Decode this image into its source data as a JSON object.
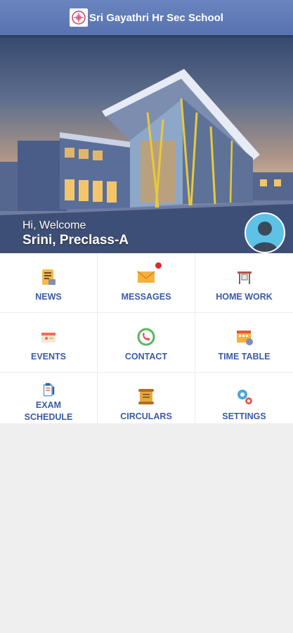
{
  "header": {
    "title": "Sri Gayathri Hr Sec School",
    "logo_icon": "school-logo-icon"
  },
  "hero": {
    "greeting": "Hi, Welcome",
    "student": "Srini, Preclass-A",
    "avatar_icon": "user-avatar-icon"
  },
  "menu": [
    {
      "label": "NEWS",
      "icon": "news-icon"
    },
    {
      "label": "MESSAGES",
      "icon": "envelope-icon",
      "has_badge": true
    },
    {
      "label": "HOME WORK",
      "icon": "desk-icon"
    },
    {
      "label": "EVENTS",
      "icon": "calendar-icon"
    },
    {
      "label": "CONTACT",
      "icon": "phone-icon"
    },
    {
      "label": "TIME TABLE",
      "icon": "timetable-icon"
    },
    {
      "label": "EXAM\nSCHEDULE",
      "icon": "clipboard-icon"
    },
    {
      "label": "CIRCULARS",
      "icon": "scroll-icon"
    },
    {
      "label": "SETTINGS",
      "icon": "gears-icon"
    }
  ],
  "colors": {
    "header": "#5f7bb8",
    "label": "#3a5aa6",
    "badge": "#d32f2f",
    "avatar_bg": "#5dc2e6"
  }
}
